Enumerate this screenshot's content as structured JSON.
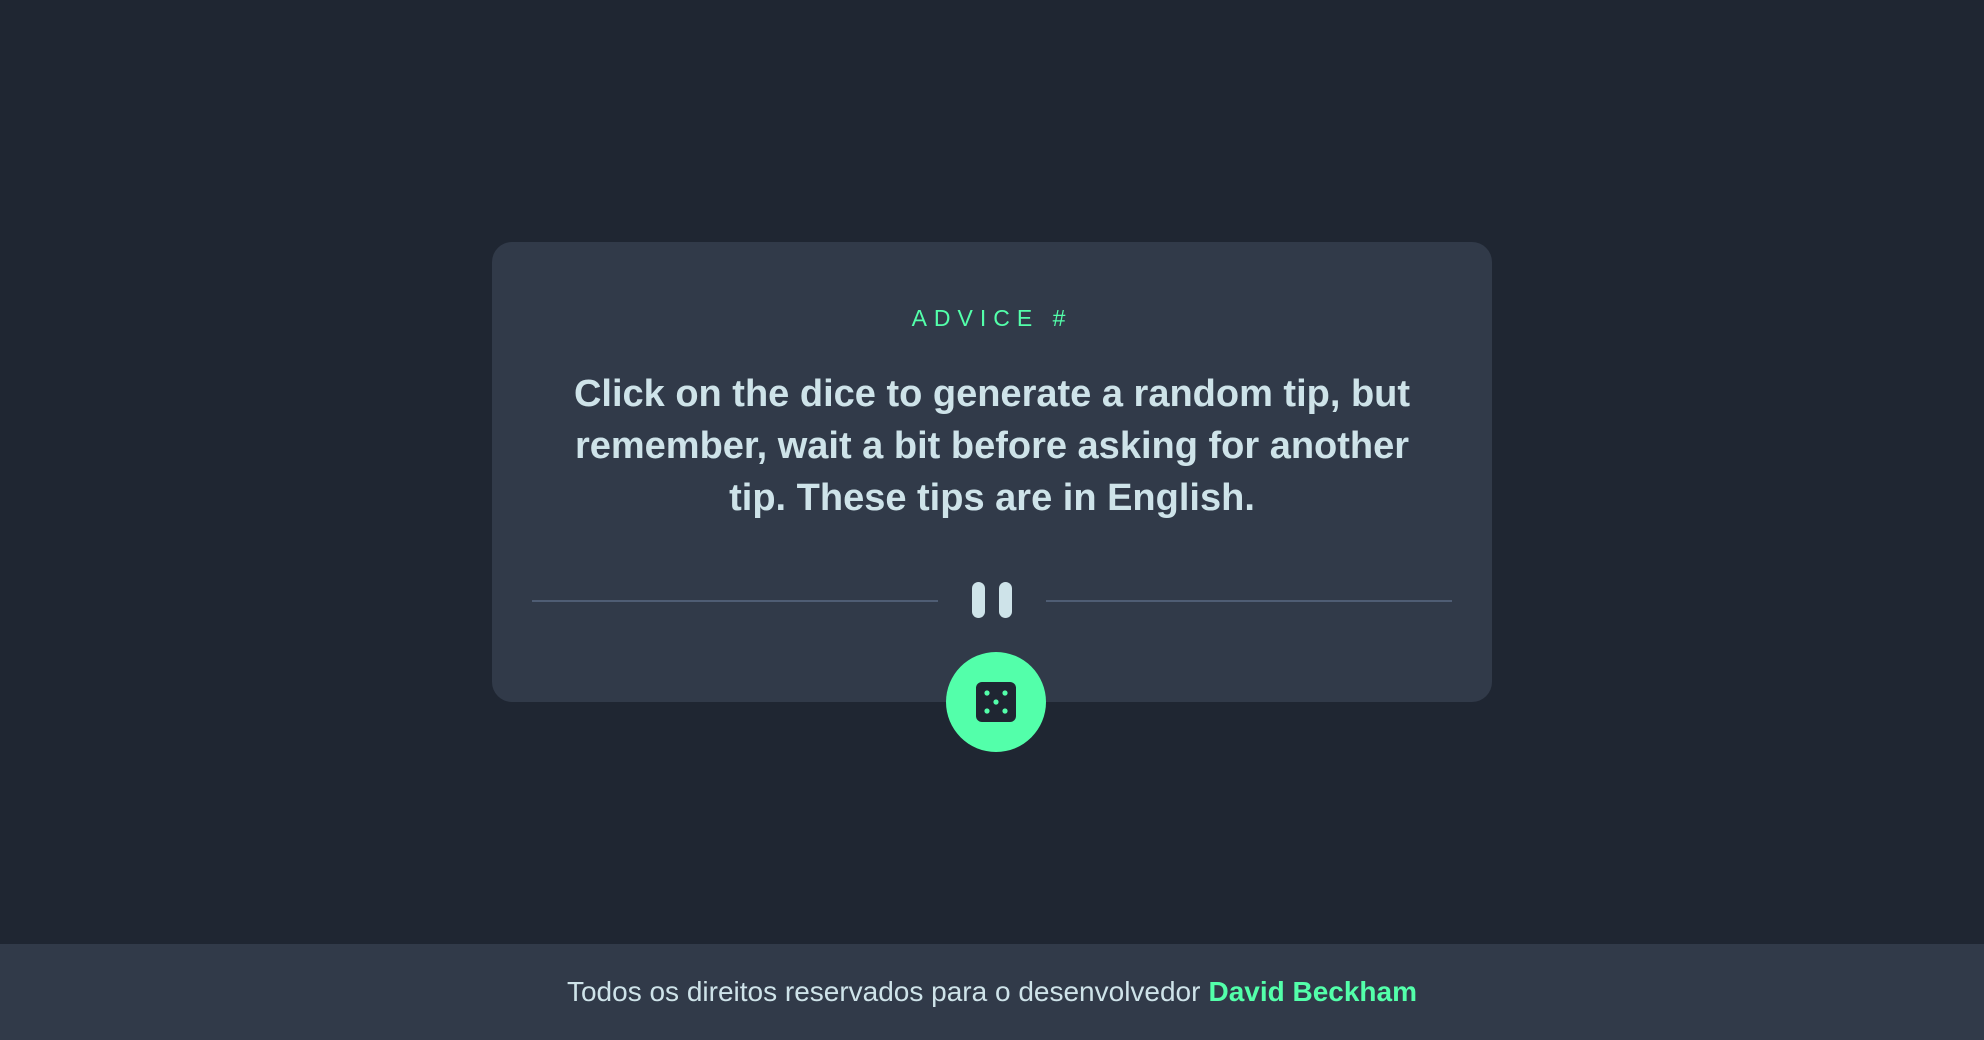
{
  "card": {
    "advice_label": "ADVICE #",
    "advice_text": "Click on the dice to generate a random tip, but remember, wait a bit before asking for another tip. These tips are in English."
  },
  "dice_button": {
    "icon": "dice-icon"
  },
  "divider": {
    "icon": "pause-icon"
  },
  "footer": {
    "text": "Todos os direitos reservados para o desenvolvedor",
    "author": "David Beckham"
  },
  "colors": {
    "background": "#1f2632",
    "card": "#313a49",
    "accent": "#53ffaa",
    "text": "#cee3e9",
    "divider": "#4f5d74"
  }
}
